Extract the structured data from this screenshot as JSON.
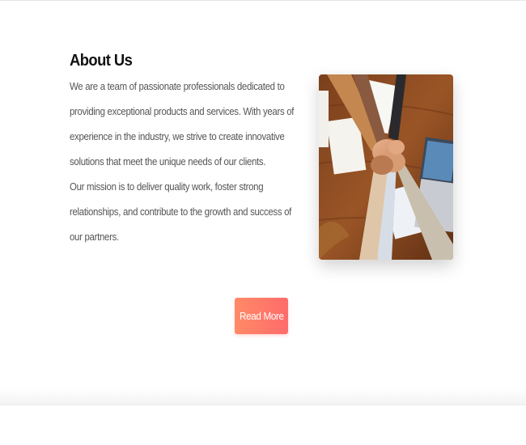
{
  "about": {
    "heading": "About Us",
    "paragraph_1": "We are a team of passionate professionals dedicated to providing exceptional products and services. With years of experience in the industry, we strive to create innovative solutions that meet the unique needs of our clients.",
    "paragraph_2": "Our mission is to deliver quality work, foster strong relationships, and contribute to the growth and success of our partners."
  },
  "image": {
    "subject": "team-hands-stacked-photo"
  },
  "cta": {
    "label": "Read More"
  },
  "colors": {
    "heading": "#111111",
    "body_text": "#555555",
    "button_start": "#ff8a66",
    "button_end": "#ff6b6b",
    "background": "#ffffff"
  }
}
